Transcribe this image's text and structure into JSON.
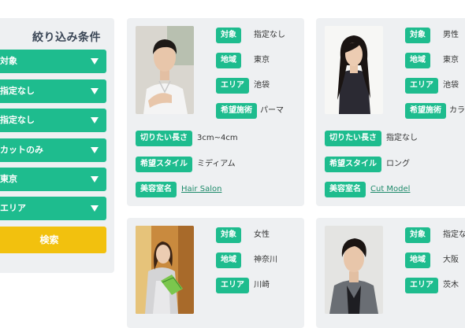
{
  "sidebar": {
    "title": "絞り込み条件",
    "filters": [
      "対象",
      "指定なし",
      "指定なし",
      "カットのみ",
      "東京",
      "エリア"
    ],
    "search_label": "検索"
  },
  "labels": {
    "target": "対象",
    "region": "地域",
    "area": "エリア",
    "treatment": "希望施術",
    "length": "切りたい長さ",
    "style": "希望スタイル",
    "salon": "美容室名"
  },
  "cards": [
    {
      "target": "指定なし",
      "region": "東京",
      "area": "池袋",
      "treatment": "パーマ",
      "length": "3cm~4cm",
      "style": "ミディアム",
      "salon": "Hair Salon"
    },
    {
      "target": "男性",
      "region": "東京",
      "area": "池袋",
      "treatment": "カラ",
      "length": "指定なし",
      "style": "ロング",
      "salon": "Cut Model"
    },
    {
      "target": "女性",
      "region": "神奈川",
      "area": "川崎"
    },
    {
      "target": "指定なし",
      "region": "大阪",
      "area": "茨木"
    }
  ]
}
